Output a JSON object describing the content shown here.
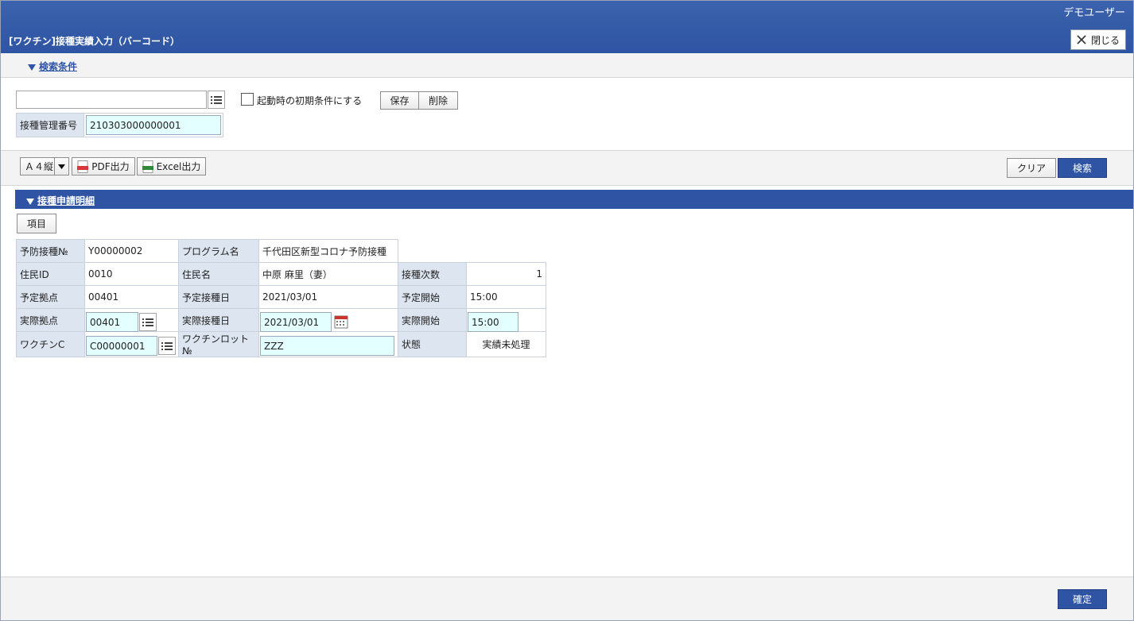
{
  "header": {
    "user_name": "デモユーザー",
    "title": "[ワクチン]接種実績入力（バーコード）",
    "close_label": "閉じる"
  },
  "search_section": {
    "title": "検索条件",
    "condition_input_value": "",
    "startup_checkbox_label": "起動時の初期条件にする",
    "startup_checked": false,
    "save_label": "保存",
    "delete_label": "削除",
    "mgmt_no_label": "接種管理番号",
    "mgmt_no_value": "210303000000001"
  },
  "toolbar": {
    "paper_size": "Ａ４縦",
    "pdf_label": "PDF出力",
    "excel_label": "Excel出力",
    "clear_label": "クリア",
    "search_label": "検索"
  },
  "detail_section": {
    "title": "接種申請明細",
    "items_button": "項目",
    "rows": {
      "prevention_no_label": "予防接種№",
      "prevention_no_value": "Y00000002",
      "program_label": "プログラム名",
      "program_value": "千代田区新型コロナ予防接種",
      "resident_id_label": "住民ID",
      "resident_id_value": "0010",
      "resident_name_label": "住民名",
      "resident_name_value": "中原 麻里（妻）",
      "dose_count_label": "接種次数",
      "dose_count_value": "1",
      "planned_site_label": "予定拠点",
      "planned_site_value": "00401",
      "planned_date_label": "予定接種日",
      "planned_date_value": "2021/03/01",
      "planned_start_label": "予定開始",
      "planned_start_value": "15:00",
      "actual_site_label": "実際拠点",
      "actual_site_value": "00401",
      "actual_date_label": "実際接種日",
      "actual_date_value": "2021/03/01",
      "actual_start_label": "実際開始",
      "actual_start_value": "15:00",
      "vaccine_code_label": "ワクチンC",
      "vaccine_code_value": "C00000001",
      "vaccine_lot_label": "ワクチンロット№",
      "vaccine_lot_value": "ZZZ",
      "status_label": "状態",
      "status_value": "実績未処理"
    }
  },
  "footer": {
    "confirm_label": "確定"
  }
}
